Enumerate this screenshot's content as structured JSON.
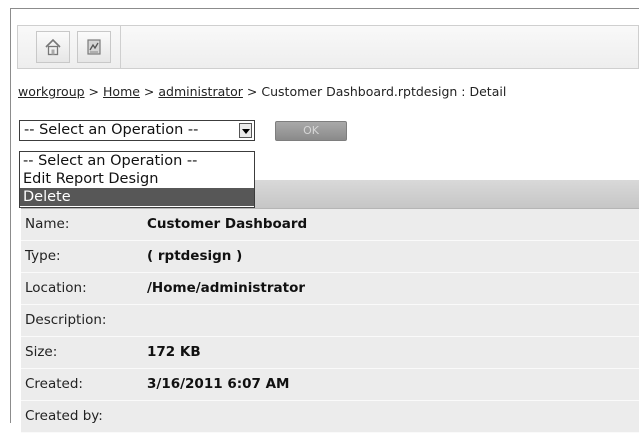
{
  "toolbar": {
    "buttons": [
      {
        "icon": "home-icon"
      },
      {
        "icon": "document-icon"
      }
    ]
  },
  "breadcrumb": {
    "items": [
      "workgroup",
      "Home",
      "administrator"
    ],
    "separator": ">",
    "current": "Customer Dashboard.rptdesign : Detail"
  },
  "operation": {
    "selected": "-- Select an Operation --",
    "options": [
      "-- Select an Operation --",
      "Edit Report Design",
      "Delete"
    ],
    "highlighted_index": 2,
    "ok_label": "OK"
  },
  "details": [
    {
      "label": "Name:",
      "value": "Customer Dashboard"
    },
    {
      "label": "Type:",
      "value": "( rptdesign )"
    },
    {
      "label": "Location:",
      "value": "/Home/administrator"
    },
    {
      "label": "Description:",
      "value": ""
    },
    {
      "label": "Size:",
      "value": "172 KB"
    },
    {
      "label": "Created:",
      "value": "3/16/2011 6:07 AM"
    },
    {
      "label": "Created by:",
      "value": ""
    }
  ],
  "colors": {
    "highlight": "#575757",
    "row_bg": "#ececec"
  }
}
